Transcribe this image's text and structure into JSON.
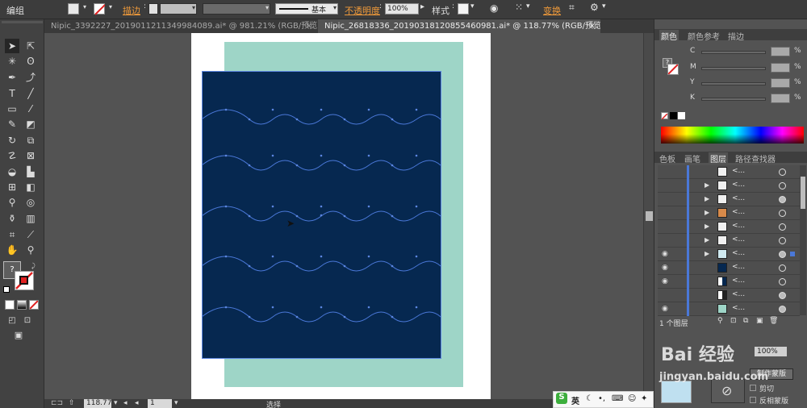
{
  "control_bar": {
    "group_label": "编组",
    "stroke_label": "描边",
    "stroke_style": "基本",
    "opacity_label": "不透明度",
    "opacity_value": "100%",
    "style_label": "样式",
    "transform_label": "变换"
  },
  "tabs": [
    {
      "label": "Nipic_3392227_20190112113499840​89.ai* @ 981.21% (RGB/预览)",
      "close": "×"
    },
    {
      "label": "Nipic_26818336_20190318120855460981.ai* @ 118.77% (RGB/预览)",
      "close": "×"
    }
  ],
  "status_bar": {
    "zoom": "118.77",
    "page": "1",
    "mode": "选择"
  },
  "color_panel": {
    "tabs": [
      "颜色",
      "颜色参考",
      "描边"
    ],
    "channels": [
      {
        "label": "C",
        "value": "",
        "unit": "%"
      },
      {
        "label": "M",
        "value": "",
        "unit": "%"
      },
      {
        "label": "Y",
        "value": "",
        "unit": "%"
      },
      {
        "label": "K",
        "value": "",
        "unit": "%"
      }
    ]
  },
  "layers_panel": {
    "tabs": [
      "色板",
      "画笔",
      "图层",
      "路径查找器"
    ],
    "rows": [
      {
        "name": "<...",
        "eye": false,
        "expand": false,
        "target": "o"
      },
      {
        "name": "<...",
        "eye": false,
        "expand": true,
        "target": "o"
      },
      {
        "name": "<...",
        "eye": false,
        "expand": true,
        "target": "●"
      },
      {
        "name": "<...",
        "eye": false,
        "expand": true,
        "target": "o"
      },
      {
        "name": "<...",
        "eye": false,
        "expand": true,
        "target": "o"
      },
      {
        "name": "<...",
        "eye": false,
        "expand": true,
        "target": "o"
      },
      {
        "name": "<...",
        "eye": true,
        "expand": true,
        "target": "◎"
      },
      {
        "name": "<...",
        "eye": true,
        "expand": false,
        "target": "o"
      },
      {
        "name": "<...",
        "eye": true,
        "expand": false,
        "target": "o"
      },
      {
        "name": "<...",
        "eye": false,
        "expand": false,
        "target": "●"
      },
      {
        "name": "<...",
        "eye": true,
        "expand": false,
        "target": "●"
      }
    ],
    "footer": "1 个图层"
  },
  "transparency_panel": {
    "opacity": "100%",
    "make_mask": "制作蒙版",
    "clip": "剪切",
    "invert_mask": "反相蒙版"
  },
  "watermark": {
    "brand": "Bai 经验",
    "url": "jingyan.baidu.com"
  },
  "ime_bar": {
    "lang": "英"
  },
  "colors": {
    "navy": "#062850",
    "teal": "#9ed5c7",
    "wave_path": "#4a78d8",
    "accent_orange": "#f09a3a"
  }
}
